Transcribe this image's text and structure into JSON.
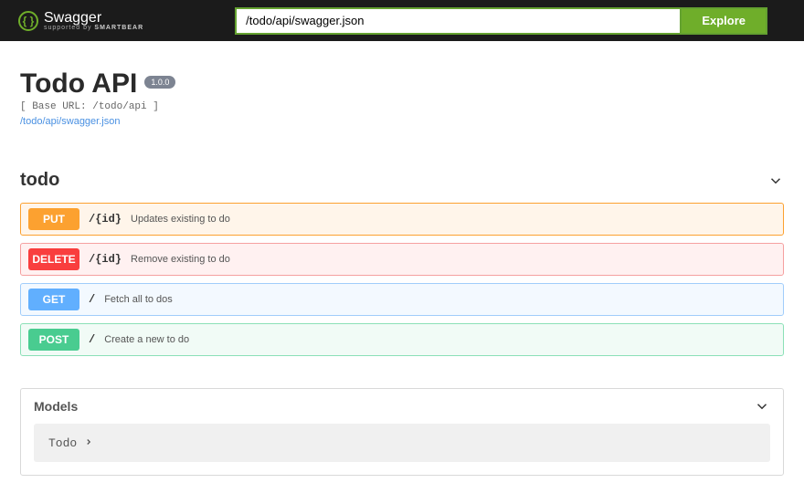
{
  "header": {
    "brand": "Swagger",
    "brand_sub_prefix": "supported by ",
    "brand_sub_bold": "SMARTBEAR",
    "url_input": "/todo/api/swagger.json",
    "explore_label": "Explore"
  },
  "api": {
    "title": "Todo API",
    "version": "1.0.0",
    "baseurl_prefix": "[ Base URL: ",
    "baseurl_value": "/todo/api",
    "baseurl_suffix": " ]",
    "spec_link": "/todo/api/swagger.json"
  },
  "tag": {
    "name": "todo"
  },
  "ops": {
    "put": {
      "method": "PUT",
      "path": "/{id}",
      "desc": "Updates existing to do"
    },
    "delete": {
      "method": "DELETE",
      "path": "/{id}",
      "desc": "Remove existing to do"
    },
    "get": {
      "method": "GET",
      "path": "/",
      "desc": "Fetch all to dos"
    },
    "post": {
      "method": "POST",
      "path": "/",
      "desc": "Create a new to do"
    }
  },
  "models": {
    "heading": "Models",
    "item": "Todo"
  }
}
